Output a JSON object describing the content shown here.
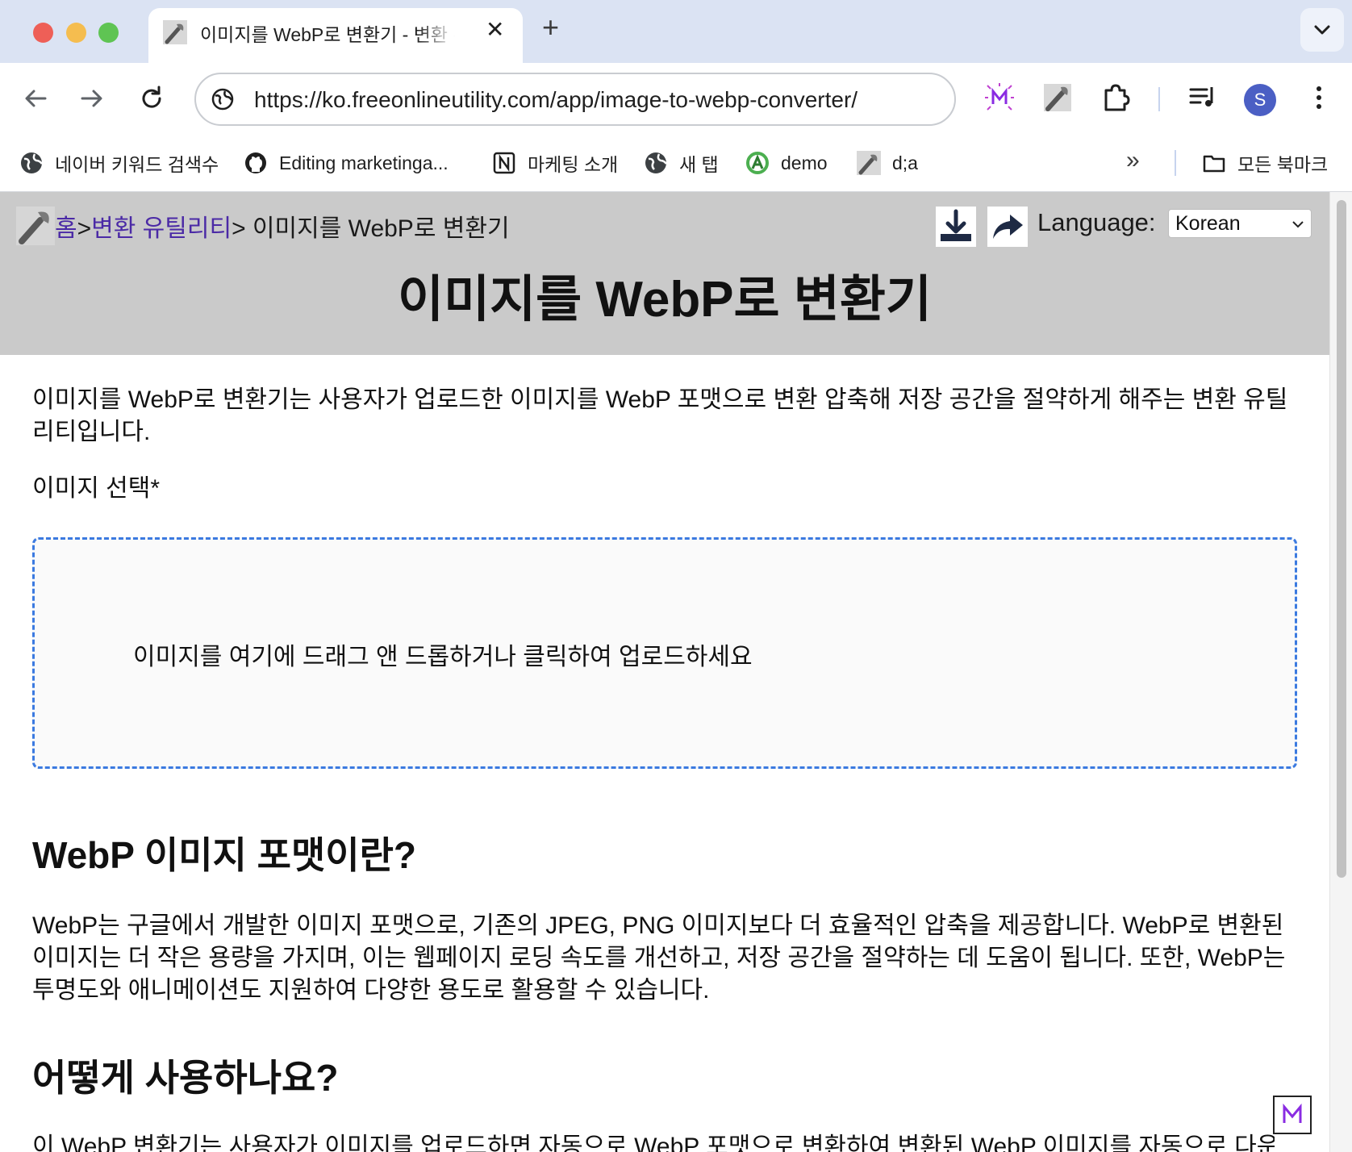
{
  "browser": {
    "tab": {
      "title": "이미지를 WebP로 변환기 - 변환 유틸리티"
    },
    "address": {
      "url": "https://ko.freeonlineutility.com/app/image-to-webp-converter/"
    },
    "avatar_initial": "S",
    "bookmarks": [
      {
        "label": "네이버 키워드 검색수",
        "icon": "globe-icon"
      },
      {
        "label": "Editing marketinga...",
        "icon": "github-icon"
      },
      {
        "label": "마케팅 소개",
        "icon": "notion-icon"
      },
      {
        "label": "새 탭",
        "icon": "globe-icon"
      },
      {
        "label": "demo",
        "icon": "demo-icon"
      },
      {
        "label": "d;a",
        "icon": "wrench-icon"
      }
    ],
    "all_bookmarks": "모든 북마크"
  },
  "page": {
    "breadcrumb": {
      "home": "홈",
      "sep1": ">",
      "category": "변환 유틸리티",
      "current": "> 이미지를 WebP로 변환기"
    },
    "language": {
      "label": "Language:",
      "selected": "Korean"
    },
    "title": "이미지를 WebP로 변환기",
    "intro": "이미지를 WebP로 변환기는 사용자가 업로드한 이미지를 WebP 포맷으로 변환 압축해 저장 공간을 절약하게 해주는 변환 유틸리티입니다.",
    "select_label": "이미지 선택*",
    "dropzone_text": "이미지를 여기에 드래그 앤 드롭하거나 클릭하여 업로드하세요",
    "section1": {
      "heading": "WebP 이미지 포맷이란?",
      "body": "WebP는 구글에서 개발한 이미지 포맷으로, 기존의 JPEG, PNG 이미지보다 더 효율적인 압축을 제공합니다. WebP로 변환된 이미지는 더 작은 용량을 가지며, 이는 웹페이지 로딩 속도를 개선하고, 저장 공간을 절약하는 데 도움이 됩니다. 또한, WebP는 투명도와 애니메이션도 지원하여 다양한 용도로 활용할 수 있습니다."
    },
    "section2": {
      "heading": "어떻게 사용하나요?",
      "body": "이 WebP 변환기는 사용자가 이미지를 업로드하면 자동으로 WebP 포맷으로 변환하여 변환된 WebP 이미지를 자동으로 다운로드합니다."
    }
  },
  "colors": {
    "accent_dashed": "#3b7ae0",
    "header_bg": "#cacaca",
    "link": "#4b2aa6",
    "avatar": "#4b5fc4"
  }
}
